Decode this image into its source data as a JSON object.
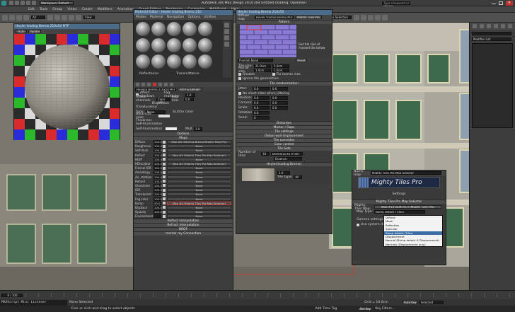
{
  "titlebar": {
    "workspace": "Workspace: Default",
    "app_title": "Autodesk 3ds Max Design 2014 x64     Untitled (loading: OpenAxe)",
    "search_placeholder": "Type a keyword or phrase"
  },
  "menubar": {
    "items": [
      "Edit",
      "Tools",
      "Group",
      "Views",
      "Create",
      "Modifiers",
      "Animation",
      "Graph Editors",
      "Rendering",
      "Customize",
      "MAXScript",
      "Help"
    ]
  },
  "toolbar": {
    "filter": "All",
    "view": "View",
    "selection_set": "Create Selection Se"
  },
  "viewport": {
    "colors": {
      "bg": "#6f6d66",
      "building": "#b8b6ae",
      "window": "#3f6a4a",
      "glass": "#9aa8b5",
      "frame": "#d6d0b0",
      "floor": "#8e8b82"
    }
  },
  "preview_window": {
    "title": "Heyler trading Bremo 210x50 MTF",
    "toolbar_label": "Auto",
    "update_btn": "Update",
    "checker_colors": [
      "#d92b2b",
      "#2a2bd9",
      "#2bb82b",
      "#2a2a2a",
      "#d9d9d9"
    ]
  },
  "material_editor": {
    "title": "Material Editor - Heyler trading Bremo 210",
    "menu": [
      "Modes",
      "Material",
      "Navigation",
      "Options",
      "Utilities"
    ],
    "reflectance_label": "Reflectance",
    "transmittance_label": "Transmittance",
    "refl_avg": "Avg",
    "refl_max": "Max",
    "refl_diffuse": "Diffuse",
    "material_name": "Heyling Bremo 210x50 MTF",
    "material_type": "Arch & Design",
    "affect_shadows": "Affect shadows",
    "fog_multiplier_label": "Fog multiplier",
    "fog_multiplier": "1.0",
    "affect_channel_label": "Affect channels",
    "affect_channel": "Color only",
    "fog_bias_label": "Fog bias",
    "fog_bias": "0.0",
    "dispersion_label": "Dispersion",
    "translucency_label": "Translucency",
    "type_label": "Type",
    "type_value": "None",
    "back_side_color": "Back-side color",
    "scatter_color": "Scatter color",
    "thickness_label": "Thickness",
    "self_illum_label": "Self-Illumination",
    "self_illumination_label": "Self-Illumination",
    "multiplier_label": "Mult",
    "multiplier": "1.0",
    "options_section": "Options",
    "maps_section": "Maps",
    "map_rows": [
      {
        "label": "Diffuse",
        "amt": "100.0",
        "slot": "Map #0 (Heyling Bremo Mighty Tiles Pro)"
      },
      {
        "label": "Roughness",
        "amt": "100.0",
        "slot": "None"
      },
      {
        "label": "Self-illum",
        "amt": "100.0",
        "slot": "None"
      },
      {
        "label": "Reflect",
        "amt": "100.0",
        "slot": "Map #2 (Mighty Tiles Pro Map Selector)"
      },
      {
        "label": "HDiff",
        "amt": "100.0",
        "slot": "None"
      },
      {
        "label": "HDiscolour",
        "amt": "100.0",
        "slot": "Map #3 (Mighty Tiles Pro Map Selector)"
      },
      {
        "label": "Fresnel IOR",
        "amt": "100.0",
        "slot": "None"
      },
      {
        "label": "Anisotropy",
        "amt": "100.0",
        "slot": "None"
      },
      {
        "label": "An. rotation",
        "amt": "100.0",
        "slot": "None"
      },
      {
        "label": "Refract",
        "amt": "100.0",
        "slot": "None"
      },
      {
        "label": "Glossiness",
        "amt": "100.0",
        "slot": "None"
      },
      {
        "label": "IOR",
        "amt": "100.0",
        "slot": "None"
      },
      {
        "label": "Translucent",
        "amt": "100.0",
        "slot": "None"
      },
      {
        "label": "Fog color",
        "amt": "100.0",
        "slot": "None"
      },
      {
        "label": "Bump",
        "amt": "40.0",
        "slot": "Map #4 (Mighty Tiles Pro Map Selector)"
      },
      {
        "label": "Displace",
        "amt": "100.0",
        "slot": "None"
      },
      {
        "label": "Opacity",
        "amt": "100.0",
        "slot": "None"
      },
      {
        "label": "Environment",
        "amt": "",
        "slot": "None"
      }
    ],
    "bottom_sections": [
      "Reflect interpolation",
      "Refract interpolation",
      "BRDF",
      "mental ray Connection"
    ]
  },
  "tiles_panel": {
    "title": "Heyler trading Bremo 210x50",
    "diffuse_map_label": "Diffuse map",
    "map_name": "Heyler trading Bremo MTF",
    "map_type": "Mighty Tiles Pro",
    "pattern_section": "Pattern",
    "pattern_note": "Get tile size of marked tile below",
    "pattern_dropdown": "Flemish Bond",
    "reset_btn": "Reset",
    "tile_size_label": "Tile size:",
    "tile_size_x": "21.0cm",
    "tile_size_y": "5.0cm",
    "mortar_size_label": "Mortar size:",
    "mortar_x": "1.0cm",
    "mortar_y": "1.0cm",
    "disable_label": "Disable",
    "fix_mortar": "Fix mortar size",
    "ignore_geom": "Ignore tile geometries",
    "tile_rand_section": "Tile randomization",
    "jitter_label": "Jitter:",
    "jitter": "0.0",
    "no_short_label": "No short sides when jittering",
    "position_label": "Position:",
    "corners_label": "Corners:",
    "scale_label": "Scale:",
    "rotation_label": "Rotation:",
    "seed_label": "Seed:",
    "zero": "0.0",
    "seed": "0",
    "sections": [
      "Distortion",
      "Mortar / Gaps",
      "Tile settings",
      "Global wall displacement",
      "Tile overrides",
      "Color control",
      "Tile Sets"
    ],
    "num_tiles_label": "Number of tiles:",
    "num_tiles": "10",
    "tileset_name": "Bremo(up to 9 tile)",
    "tileset_type": "Essence",
    "subtitle": "Heyler(trading Bremo)",
    "tile_type_label": "Tile type:",
    "tile_type": "All",
    "tile_val": "1.0"
  },
  "map_selector": {
    "name_label": "Name map",
    "name_value": "Mighty Tiles Pro Map Selector",
    "logo": "Mighty Tiles Pro",
    "settings": "Settings",
    "section": "Mighty Tiles Pro Map Selector",
    "tiles_map_label": "Mighty Tiles Map:",
    "tiles_map_value": "Map #107039(767) (Mighty Tiles Pro)",
    "map_type_label": "Map Type:",
    "map_type_value": "Bump details (Tiles)",
    "gamma_label": "Gamma settings",
    "use_system": "Use system default",
    "options": [
      "Diffuse",
      "Mask",
      "Reflection",
      "Specular",
      "Bump details (Tiles)",
      "Displacement",
      "Normal (Bump details & Displacement)",
      "Normals (Displacement only)"
    ],
    "selected_index": 4,
    "gamma_value": "1.0"
  },
  "timeline": {
    "frame": "0 / 100"
  },
  "status": {
    "selection": "None Selected",
    "prompt": "Click or click-and-drag to select objects",
    "grid": "Grid = 10.0cm",
    "auto_key": "Auto Key",
    "selected": "Selected",
    "set_key": "Set Key",
    "key_filters": "Key Filters...",
    "add_time_tag": "Add Time Tag",
    "script": "MAXScript Mini Listener"
  },
  "right_panel": {
    "label": "Modifier List"
  }
}
